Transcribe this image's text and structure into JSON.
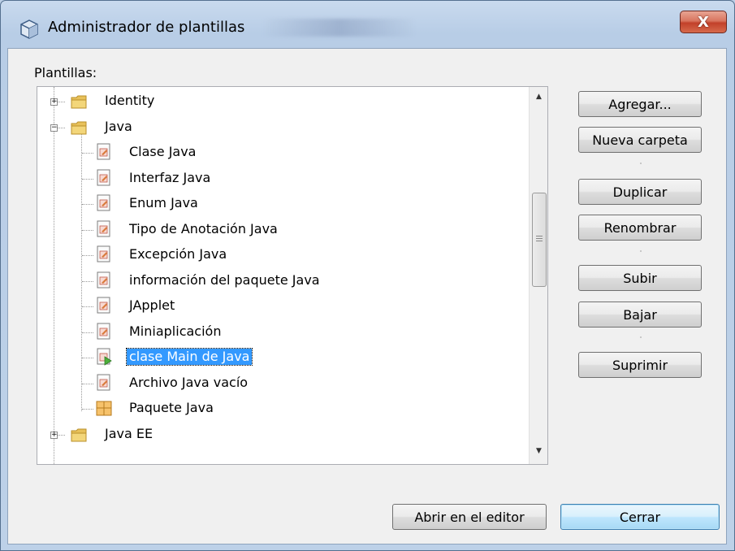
{
  "window": {
    "title": "Administrador de plantillas",
    "close_glyph": "X"
  },
  "tree": {
    "label": "Plantillas:",
    "items": [
      {
        "label": "Identity",
        "type": "folder",
        "expanded": false
      },
      {
        "label": "Java",
        "type": "folder",
        "expanded": true
      },
      {
        "label": "Clase Java",
        "type": "template"
      },
      {
        "label": "Interfaz Java",
        "type": "template"
      },
      {
        "label": "Enum Java",
        "type": "template"
      },
      {
        "label": "Tipo de Anotación Java",
        "type": "template"
      },
      {
        "label": "Excepción Java",
        "type": "template"
      },
      {
        "label": "información del paquete Java",
        "type": "template"
      },
      {
        "label": "JApplet",
        "type": "template"
      },
      {
        "label": "Miniaplicación",
        "type": "template"
      },
      {
        "label": "clase Main de Java",
        "type": "template-main",
        "selected": true
      },
      {
        "label": "Archivo Java vacío",
        "type": "template"
      },
      {
        "label": "Paquete Java",
        "type": "package"
      },
      {
        "label": "Java EE",
        "type": "folder",
        "expanded": false
      }
    ]
  },
  "buttons": {
    "agregar": "Agregar...",
    "nueva_carpeta": "Nueva carpeta",
    "duplicar": "Duplicar",
    "renombrar": "Renombrar",
    "subir": "Subir",
    "bajar": "Bajar",
    "suprimir": "Suprimir",
    "abrir_editor": "Abrir en el editor",
    "cerrar": "Cerrar"
  },
  "colors": {
    "selection": "#3399ff",
    "folder": "#e8c15a",
    "default_button_border": "#3c7fb1"
  }
}
